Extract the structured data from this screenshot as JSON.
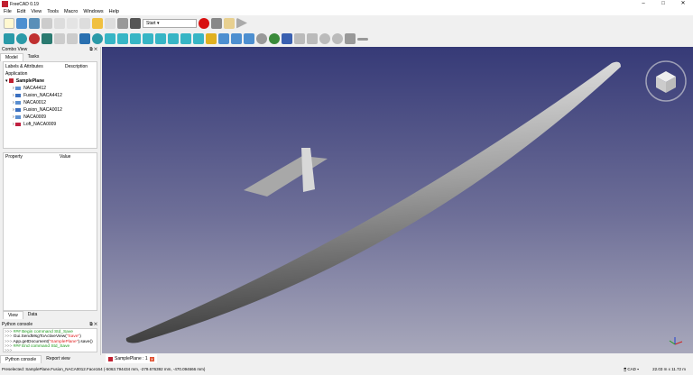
{
  "window": {
    "title": "FreeCAD 0.19",
    "controls": [
      "–",
      "□",
      "✕"
    ]
  },
  "menu": [
    "File",
    "Edit",
    "View",
    "Tools",
    "Macro",
    "Windows",
    "Help"
  ],
  "toolbar": {
    "workbench": "Start"
  },
  "combo_view": {
    "title": "Combo View",
    "tabs": [
      "Model",
      "Tasks"
    ],
    "columns": [
      "Labels & Attributes",
      "Description"
    ],
    "root_label": "Application",
    "document": "SamplePlane",
    "items": [
      {
        "label": "NACA4412",
        "color": "#5b8fd0"
      },
      {
        "label": "Fusion_NACA4412",
        "color": "#3a6fc0"
      },
      {
        "label": "NACA0012",
        "color": "#5b8fd0"
      },
      {
        "label": "Fusion_NACA0012",
        "color": "#3a6fc0"
      },
      {
        "label": "NACA0009",
        "color": "#5b8fd0"
      },
      {
        "label": "Loft_NACA0009",
        "color": "#c02040"
      }
    ],
    "property_columns": [
      "Property",
      "Value"
    ],
    "bottom_tabs": [
      "View",
      "Data"
    ]
  },
  "python_console": {
    "title": "Python console",
    "lines": [
      {
        "prompt": ">>> ",
        "parts": [
          {
            "t": "### Begin command Std_Save",
            "c": "g"
          }
        ]
      },
      {
        "prompt": ">>> ",
        "parts": [
          {
            "t": "Gui.SendMsgToActiveView(",
            "c": ""
          },
          {
            "t": "\"Save\"",
            "c": "r"
          },
          {
            "t": ")",
            "c": ""
          }
        ]
      },
      {
        "prompt": ">>> ",
        "parts": [
          {
            "t": "App.getDocument(",
            "c": ""
          },
          {
            "t": "\"SamplePlane\"",
            "c": "r"
          },
          {
            "t": ").save()",
            "c": ""
          }
        ]
      },
      {
        "prompt": ">>> ",
        "parts": [
          {
            "t": "### End command Std_Save",
            "c": "g"
          }
        ]
      },
      {
        "prompt": ">>> ",
        "parts": []
      }
    ],
    "tabs": [
      "Python console",
      "Report view"
    ]
  },
  "document_tab": {
    "label": "SamplePlane : 1"
  },
  "status": {
    "message": "Preselected: SamplePlane.Fusion_NACA0012.Face164 (-5063.794434 mm, -279.676392 mm, -470.094666 mm)",
    "nav_style": "CAD",
    "dimensions": "22.03 m x 11.72 m"
  }
}
